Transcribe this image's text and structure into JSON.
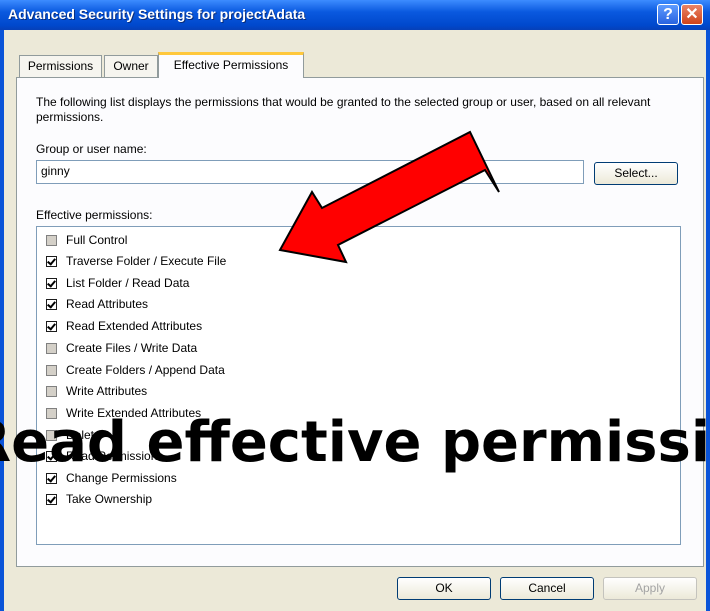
{
  "window": {
    "title": "Advanced Security Settings for projectAdata"
  },
  "titlebar_buttons": {
    "help": "?",
    "close": "✕"
  },
  "tabs": [
    {
      "label": "Permissions"
    },
    {
      "label": "Owner"
    },
    {
      "label": "Effective Permissions"
    }
  ],
  "description": "The following list displays the permissions that would be granted to the selected group or user, based on all relevant permissions.",
  "group_label": "Group or user name:",
  "group_value": "ginny",
  "select_button": "Select...",
  "effective_label": "Effective permissions:",
  "permissions": [
    {
      "label": "Full Control",
      "checked": false
    },
    {
      "label": "Traverse Folder / Execute File",
      "checked": true
    },
    {
      "label": "List Folder / Read Data",
      "checked": true
    },
    {
      "label": "Read Attributes",
      "checked": true
    },
    {
      "label": "Read Extended Attributes",
      "checked": true
    },
    {
      "label": "Create Files / Write Data",
      "checked": false
    },
    {
      "label": "Create Folders / Append Data",
      "checked": false
    },
    {
      "label": "Write Attributes",
      "checked": false
    },
    {
      "label": "Write Extended Attributes",
      "checked": false
    },
    {
      "label": "Delete",
      "checked": false
    },
    {
      "label": "Read Permissions",
      "checked": true
    },
    {
      "label": "Change Permissions",
      "checked": true
    },
    {
      "label": "Take Ownership",
      "checked": true
    }
  ],
  "buttons": {
    "ok": "OK",
    "cancel": "Cancel",
    "apply": "Apply"
  },
  "overlay_caption": "Read effective permissions",
  "colors": {
    "arrow": "#ff0000",
    "titlebar": "#0a54d8",
    "dialog_bg": "#ece9d8"
  }
}
